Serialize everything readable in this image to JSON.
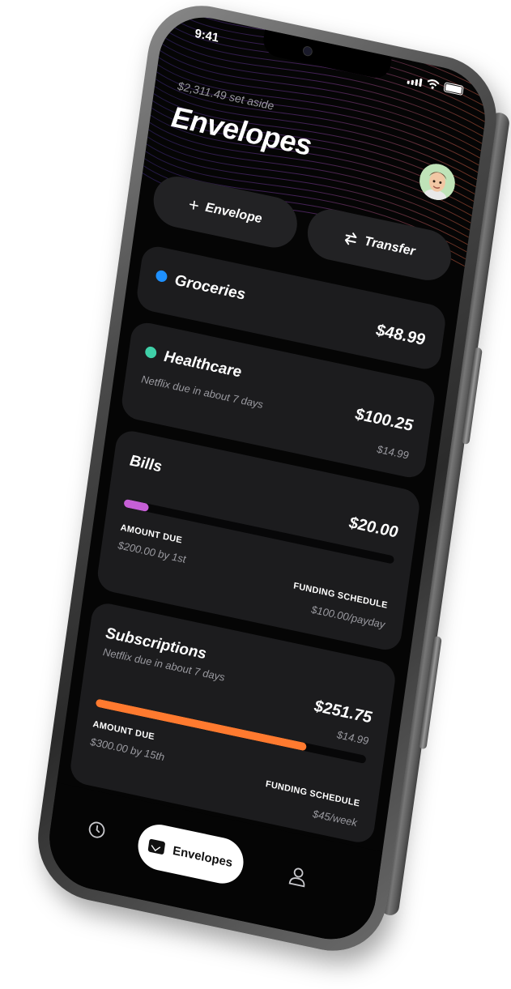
{
  "status_bar": {
    "time": "9:41"
  },
  "header": {
    "set_aside": "$2,311.49 set aside",
    "title": "Envelopes",
    "avatar_icon": "memoji-avatar-icon"
  },
  "actions": {
    "add_envelope": {
      "label": "Envelope",
      "icon": "plus-icon"
    },
    "transfer": {
      "label": "Transfer",
      "icon": "transfer-arrows-icon"
    }
  },
  "envelopes": [
    {
      "name": "Groceries",
      "amount": "$48.99",
      "dot_color": "#1e90ff"
    },
    {
      "name": "Healthcare",
      "amount": "$100.25",
      "note": "Netflix due in about 7 days",
      "note_amount": "$14.99",
      "dot_color": "#3fd0a8"
    },
    {
      "name": "Bills",
      "amount": "$20.00",
      "progress": 0.09,
      "bar_color": "#c65fd6",
      "amount_due_label": "AMOUNT DUE",
      "amount_due_value": "$200.00 by 1st",
      "funding_label": "FUNDING SCHEDULE",
      "funding_value": "$100.00/payday"
    },
    {
      "name": "Subscriptions",
      "amount": "$251.75",
      "note": "Netflix due in about 7 days",
      "note_amount": "$14.99",
      "progress": 0.78,
      "bar_color": "#ff7a2f",
      "amount_due_label": "AMOUNT DUE",
      "amount_due_value": "$300.00 by 15th",
      "funding_label": "FUNDING SCHEDULE",
      "funding_value": "$45/week"
    }
  ],
  "tabbar": {
    "history_icon": "clock-icon",
    "active_tab": {
      "label": "Envelopes",
      "icon": "envelope-icon"
    },
    "profile_icon": "person-icon"
  }
}
